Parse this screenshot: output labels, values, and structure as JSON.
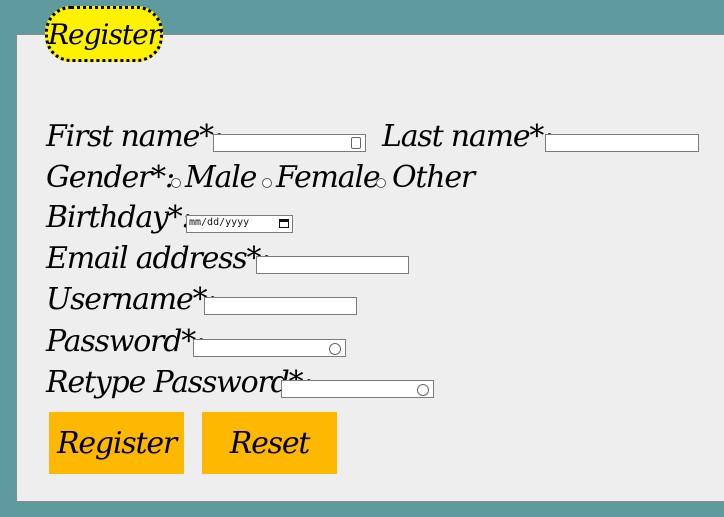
{
  "form": {
    "legend": "Register",
    "fields": {
      "first_name_label": "First name*:",
      "first_name_value": "",
      "last_name_label": "Last name*:",
      "last_name_value": "",
      "gender_label": "Gender*:",
      "gender_options": [
        "Male",
        "Female",
        "Other"
      ],
      "birthday_label": "Birthday*:",
      "birthday_placeholder": "mm/dd/yyyy",
      "email_label": "Email address*:",
      "email_value": "",
      "username_label": "Username*:",
      "username_value": "",
      "password_label": "Password*:",
      "password_value": "",
      "retype_password_label": "Retype Password*:",
      "retype_password_value": ""
    },
    "buttons": {
      "register_label": "Register",
      "reset_label": "Reset"
    }
  },
  "colors": {
    "background": "#5f9a9e",
    "panel": "#eeeeef",
    "legend_fill": "#fff200",
    "button_fill": "#ffb800"
  },
  "icons": {
    "first_name_input": "contact-card-icon",
    "password_input": "key-icon",
    "birthday_input": "calendar-icon"
  }
}
